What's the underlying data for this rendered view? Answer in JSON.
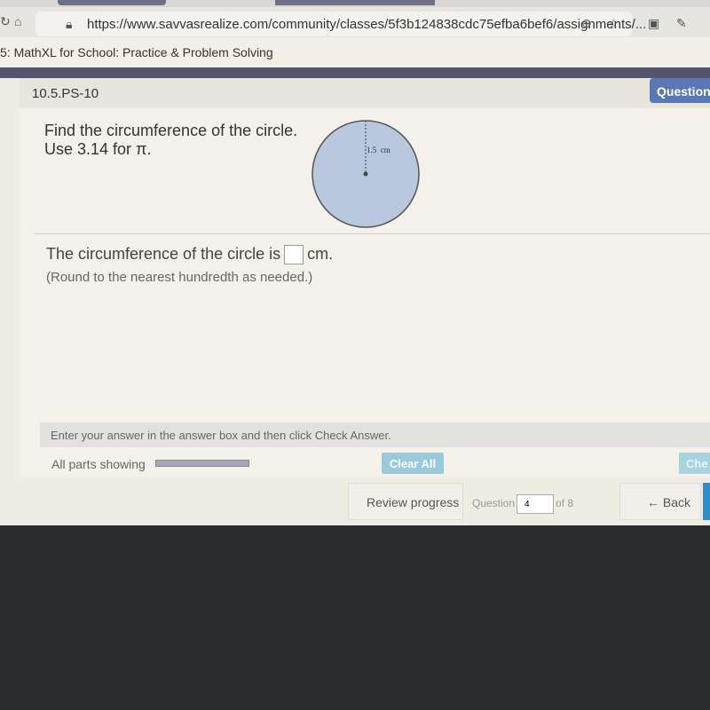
{
  "browser": {
    "url": "https://www.savvasrealize.com/community/classes/5f3b124838cdc75efba6bef6/assignments/...",
    "icons": [
      "refresh-icon",
      "home-icon",
      "lock-icon",
      "zoom-icon",
      "favorites-icon",
      "collections-icon",
      "read-aloud-icon"
    ]
  },
  "breadcrumb": "5: MathXL for School: Practice & Problem Solving",
  "question": {
    "id": "10.5.PS-10",
    "tab_label": "Question"
  },
  "problem": {
    "line1": "Find the circumference of the circle.",
    "line2": "Use 3.14 for π.",
    "radius_label": "1.5  cm"
  },
  "answer": {
    "prefix": "The circumference of the circle is",
    "value": "",
    "suffix": "cm.",
    "note": "(Round to the nearest hundredth as needed.)"
  },
  "footer": {
    "help": "Enter your answer in the answer box and then click Check Answer.",
    "parts_label": "All parts showing",
    "parts_progress_percent": 100,
    "clear_all": "Clear All",
    "check_answer": "Che"
  },
  "nav": {
    "review": "Review progress",
    "question_label": "Question",
    "question_number": "4",
    "of_label": "of 8",
    "back": "← Back"
  },
  "colors": {
    "accent": "#5a78b5",
    "clear_button": "#9ac9dc",
    "next_button": "#2f8ec7",
    "circle_fill": "#b9c8de"
  }
}
